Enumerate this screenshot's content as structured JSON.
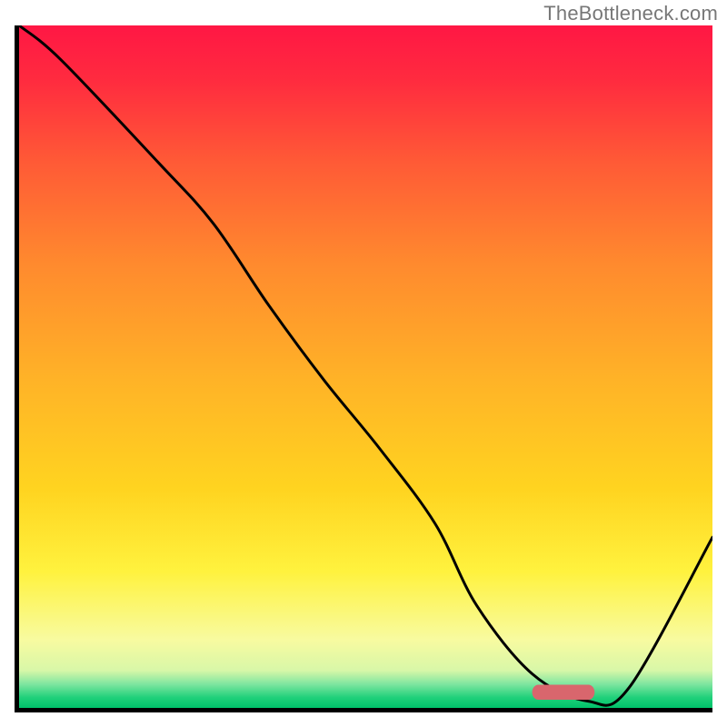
{
  "watermark": "TheBottleneck.com",
  "gradient": {
    "stops": [
      {
        "pos": 0.0,
        "color": "#ff1744"
      },
      {
        "pos": 0.08,
        "color": "#ff2b3f"
      },
      {
        "pos": 0.2,
        "color": "#ff5a36"
      },
      {
        "pos": 0.35,
        "color": "#ff8a2e"
      },
      {
        "pos": 0.52,
        "color": "#ffb327"
      },
      {
        "pos": 0.68,
        "color": "#ffd420"
      },
      {
        "pos": 0.8,
        "color": "#fff23e"
      },
      {
        "pos": 0.9,
        "color": "#f8fba0"
      },
      {
        "pos": 0.945,
        "color": "#d8f7a8"
      },
      {
        "pos": 0.965,
        "color": "#7fe6a0"
      },
      {
        "pos": 0.985,
        "color": "#1fd07a"
      },
      {
        "pos": 1.0,
        "color": "#00c26a"
      }
    ]
  },
  "chart_data": {
    "type": "line",
    "title": "",
    "xlabel": "",
    "ylabel": "",
    "xlim": [
      0,
      100
    ],
    "ylim": [
      0,
      100
    ],
    "categories": [
      0,
      6,
      20,
      28,
      36,
      44,
      52,
      60,
      66,
      74,
      82,
      88,
      100
    ],
    "values": [
      100,
      95,
      80,
      71,
      59,
      48,
      38,
      27,
      15,
      5,
      1,
      3,
      25
    ],
    "marker": {
      "x_start": 74,
      "x_end": 83,
      "y": 2.3,
      "color": "#d9666d"
    }
  }
}
